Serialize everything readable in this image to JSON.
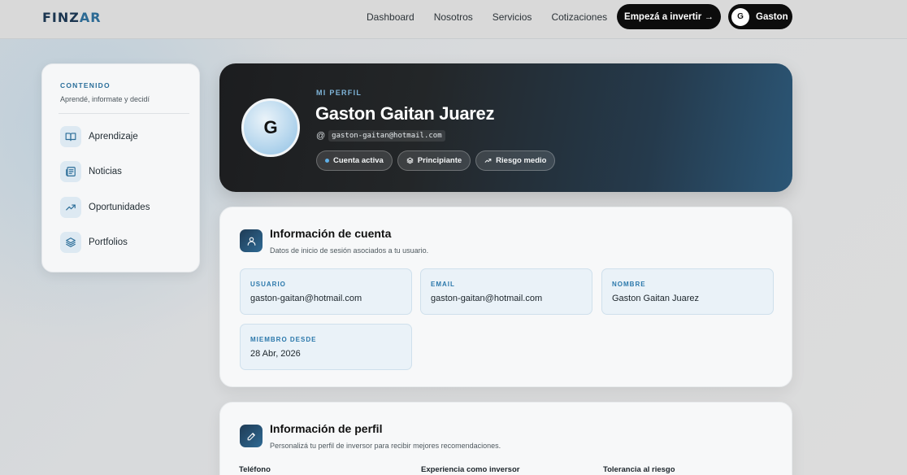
{
  "brand": {
    "part1": "FINZ",
    "part2": "AR"
  },
  "nav": {
    "links": [
      "Dashboard",
      "Nosotros",
      "Servicios",
      "Cotizaciones"
    ],
    "cta": "Empezá a invertir →",
    "user_initial": "G",
    "user_name": "Gaston"
  },
  "sidebar": {
    "title": "CONTENIDO",
    "subtitle": "Aprendé, informate y decidí",
    "items": [
      {
        "label": "Aprendizaje",
        "icon": "book-icon"
      },
      {
        "label": "Noticias",
        "icon": "newspaper-icon"
      },
      {
        "label": "Oportunidades",
        "icon": "trending-up-icon"
      },
      {
        "label": "Portfolios",
        "icon": "layers-icon"
      }
    ]
  },
  "hero": {
    "kicker": "MI PERFIL",
    "initial": "G",
    "name": "Gaston Gaitan Juarez",
    "at": "@",
    "email": "gaston-gaitan@hotmail.com",
    "chips": [
      "Cuenta activa",
      "Principiante",
      "Riesgo medio"
    ]
  },
  "account": {
    "title": "Información de cuenta",
    "subtitle": "Datos de inicio de sesión asociados a tu usuario.",
    "fields": [
      {
        "label": "USUARIO",
        "value": "gaston-gaitan@hotmail.com"
      },
      {
        "label": "EMAIL",
        "value": "gaston-gaitan@hotmail.com"
      },
      {
        "label": "NOMBRE",
        "value": "Gaston Gaitan Juarez"
      },
      {
        "label": "MIEMBRO DESDE",
        "value": "28 Abr, 2026"
      }
    ]
  },
  "profile": {
    "title": "Información de perfil",
    "subtitle": "Personalizá tu perfil de inversor para recibir mejores recomendaciones.",
    "labels": [
      "Teléfono",
      "Experiencia como inversor",
      "Tolerancia al riesgo"
    ]
  }
}
